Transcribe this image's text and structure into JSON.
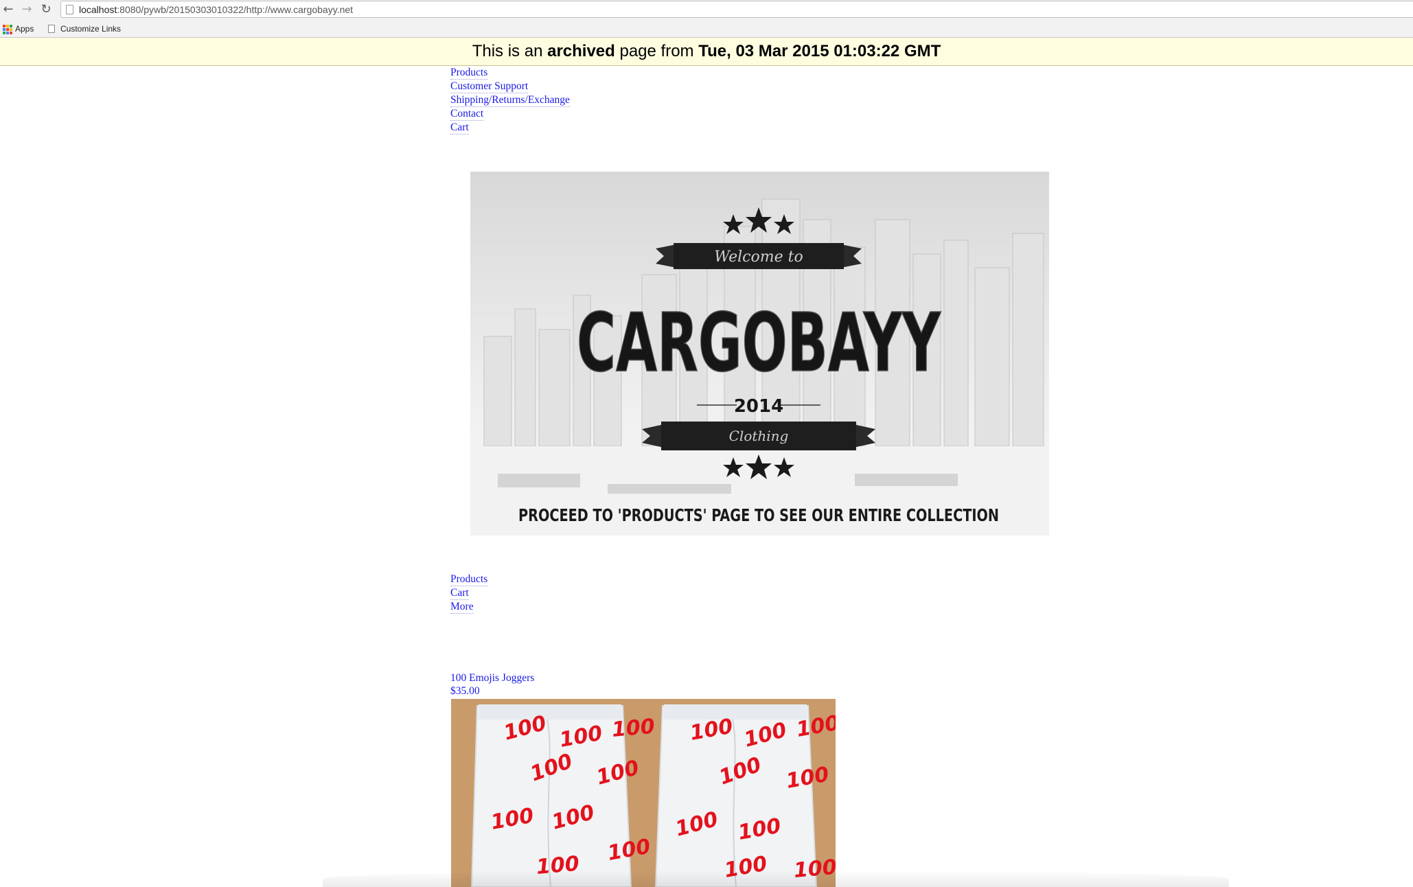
{
  "browser": {
    "url_host": "localhost",
    "url_rest": ":8080/pywb/20150303010322/http://www.cargobayy.net",
    "bookmarks": [
      {
        "label": "Apps",
        "icon": "apps-grid-icon"
      },
      {
        "label": "Customize Links",
        "icon": "page-icon"
      }
    ]
  },
  "banner": {
    "prefix": "This is an",
    "strong": "archived",
    "middle": "page from",
    "date": "Tue, 03 Mar 2015 01:03:22 GMT"
  },
  "top_nav": [
    {
      "label": "Products"
    },
    {
      "label": "Customer Support"
    },
    {
      "label": "Shipping/Returns/Exchange"
    },
    {
      "label": "Contact"
    },
    {
      "label": "Cart"
    }
  ],
  "hero": {
    "welcome": "Welcome to",
    "brand": "CARGOBAYY",
    "year": "2014",
    "subtitle": "Clothing",
    "cta": "PROCEED TO 'PRODUCTS' PAGE TO SEE  OUR  ENTIRE  COLLECTION"
  },
  "secondary_nav": [
    {
      "label": "Products"
    },
    {
      "label": "Cart"
    },
    {
      "label": "More"
    }
  ],
  "product": {
    "name": "100 Emojis Joggers",
    "price": "$35.00",
    "print": "100"
  },
  "colors": {
    "link": "#1a1ae6",
    "banner_bg": "#fffde0",
    "product_bg": "#c99b6b",
    "emoji_red": "#e3121c"
  }
}
